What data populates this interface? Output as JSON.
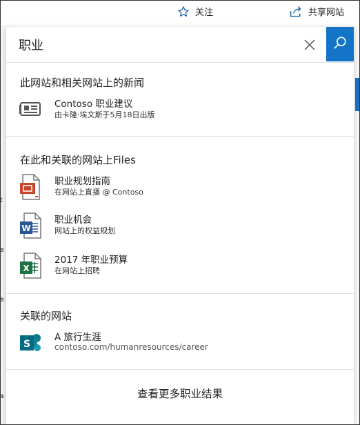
{
  "topbar": {
    "follow_label": "关注",
    "share_label": "共享网站",
    "follow_icon": "star-icon",
    "share_icon": "share-icon"
  },
  "search": {
    "value": "职业",
    "clear_icon": "close-icon",
    "search_icon": "search-icon",
    "accent_color": "#1475c8"
  },
  "sections": {
    "news": {
      "title": "此网站和相关网站上的新闻",
      "items": [
        {
          "title": "Contoso 职业建议",
          "subtitle": "由卡隆·埃文斯于5月18日出版",
          "icon": "newspaper-icon"
        }
      ]
    },
    "files": {
      "title": "在此和关联的网站上Files",
      "items": [
        {
          "title": "职业规划指南",
          "subtitle": "在网站上直播 @ Contoso",
          "icon": "powerpoint-icon"
        },
        {
          "title": "职业机会",
          "subtitle": "网站上的权益规划",
          "icon": "word-icon"
        },
        {
          "title": "2017 年职业预算",
          "subtitle": "在网站上招聘",
          "icon": "excel-icon"
        }
      ]
    },
    "sites": {
      "title": "关联的网站",
      "items": [
        {
          "title": "A 旅行生涯",
          "subtitle": "contoso.com/humanresources/career",
          "icon": "sharepoint-icon"
        }
      ]
    }
  },
  "more_results_label": "查看更多职业结果"
}
